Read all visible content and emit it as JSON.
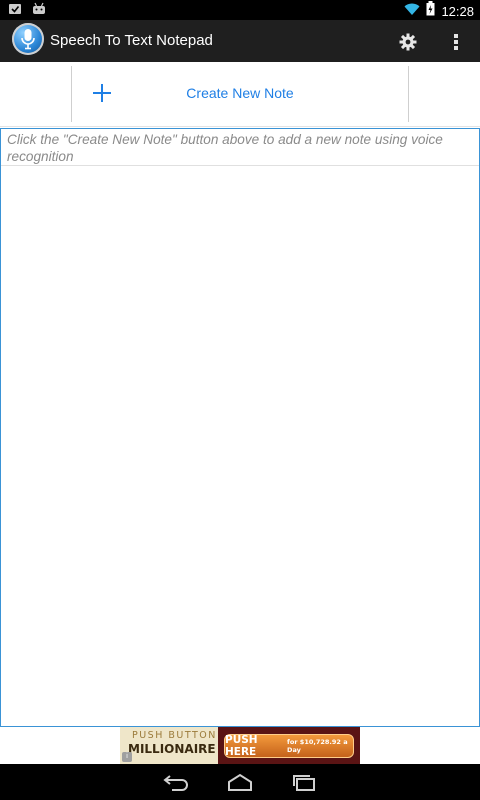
{
  "status_bar": {
    "time": "12:28",
    "icons": [
      "checkbox-notification-icon",
      "android-notification-icon",
      "wifi-icon",
      "battery-charging-icon"
    ]
  },
  "action_bar": {
    "app_icon": "microphone-icon",
    "title": "Speech To Text Notepad",
    "actions": [
      "settings-gear-icon",
      "overflow-menu-icon"
    ]
  },
  "toolbar": {
    "create_label": "Create New Note",
    "create_icon": "plus-icon"
  },
  "notes": {
    "hint": "Click the \"Create New Note\" button above to add a new note using voice recognition",
    "items": []
  },
  "ad_banner": {
    "line1": "PUSH BUTTON",
    "line2": "MILLIONAIRE",
    "cta_main": "PUSH HERE",
    "cta_sub": "for $10,728.92 a Day"
  },
  "nav_bar": {
    "buttons": [
      "back-icon",
      "home-icon",
      "recent-apps-icon"
    ]
  },
  "colors": {
    "accent": "#1f7fe5",
    "action_bar_bg": "#1f1f1f",
    "panel_border": "#3a93d6"
  }
}
